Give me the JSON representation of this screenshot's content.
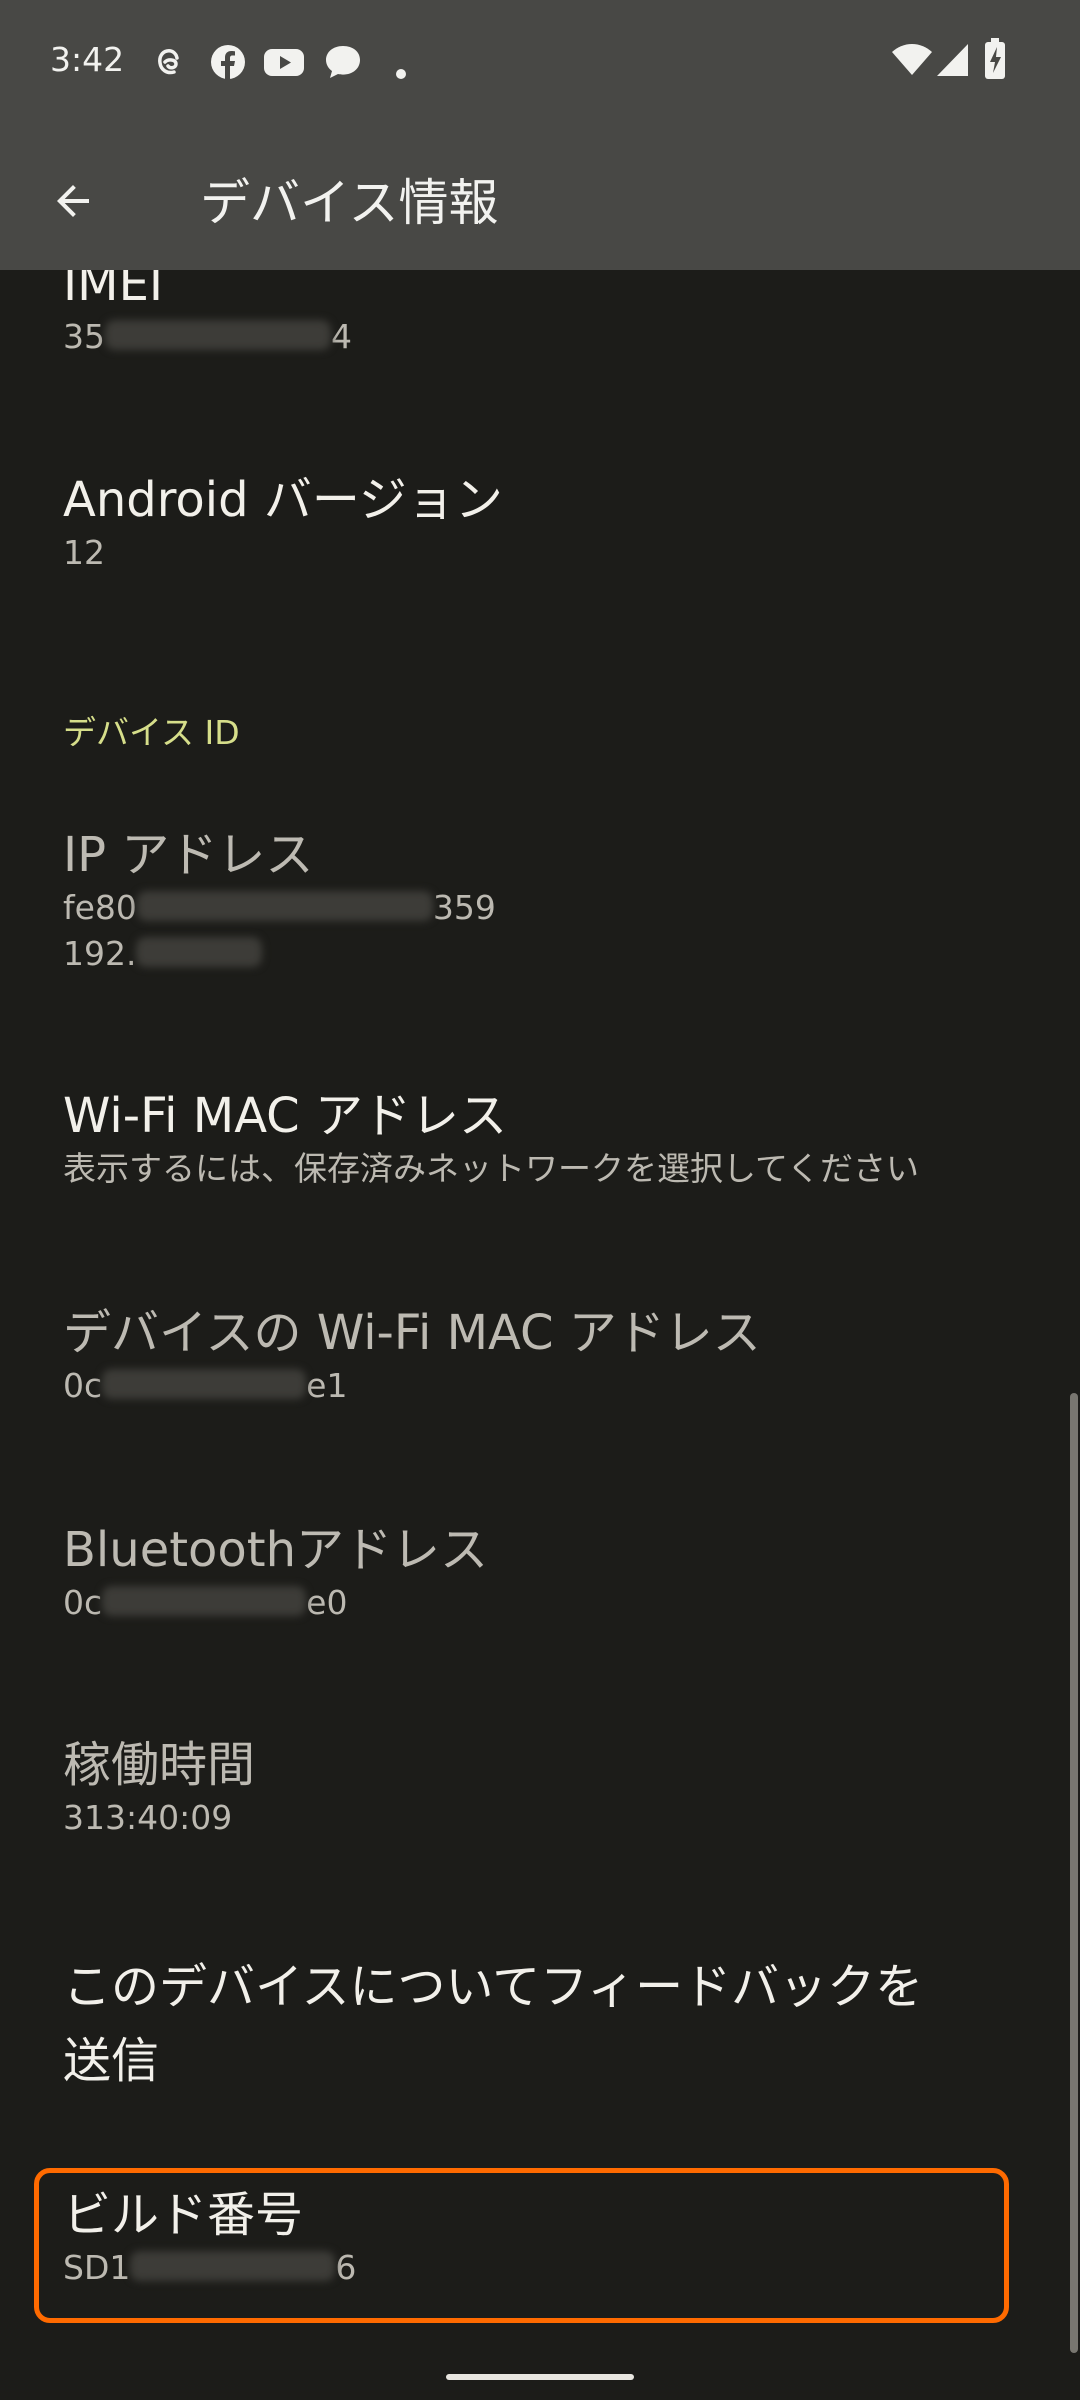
{
  "status_bar": {
    "time": "3:42",
    "notification_icons": [
      "threads-icon",
      "facebook-icon",
      "youtube-icon",
      "chat-bubble-icon",
      "more-notifications-dot-icon"
    ],
    "system_icons": [
      "wifi-icon",
      "cell-signal-icon",
      "battery-charging-icon"
    ]
  },
  "app_bar": {
    "title": "デバイス情報"
  },
  "items": {
    "imei": {
      "title": "IMEI",
      "value_prefix": "35",
      "value_suffix": "4"
    },
    "android_version": {
      "title": "Android バージョン",
      "value": "12"
    },
    "section_device_id": "デバイス ID",
    "ip_address": {
      "title": "IP アドレス",
      "line1_prefix": "fe80",
      "line1_suffix": "359",
      "line2_prefix": "192."
    },
    "wifi_mac": {
      "title": "Wi-Fi MAC アドレス",
      "value": "表示するには、保存済みネットワークを選択してください"
    },
    "device_wifi_mac": {
      "title": "デバイスの Wi-Fi MAC アドレス",
      "value_prefix": "0c",
      "value_suffix": "e1"
    },
    "bluetooth": {
      "title": "Bluetoothアドレス",
      "value_prefix": "0c",
      "value_suffix": "e0"
    },
    "uptime": {
      "title": "稼働時間",
      "value": "313:40:09"
    },
    "feedback": {
      "line1": "このデバイスについてフィードバックを",
      "line2": "送信"
    },
    "build_number": {
      "title": "ビルド番号",
      "value_prefix": "SD1",
      "value_suffix": "6"
    }
  },
  "colors": {
    "background": "#1c1c19",
    "app_bar": "#484845",
    "accent_section": "#d6de8a",
    "highlight": "#ff6a00"
  }
}
